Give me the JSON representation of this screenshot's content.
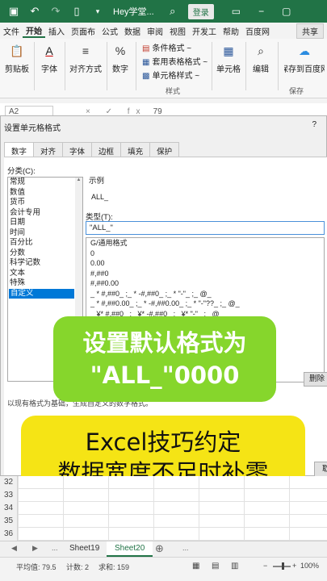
{
  "titlebar": {
    "title": "Hey学堂...",
    "login": "登录",
    "icons": [
      "save-icon",
      "undo-icon",
      "redo-icon",
      "document-icon",
      "search-icon",
      "ribbon-icon",
      "minimize-icon",
      "restore-icon"
    ]
  },
  "menu": {
    "tabs": [
      "文件",
      "开始",
      "插入",
      "页面布",
      "公式",
      "数据",
      "审阅",
      "视图",
      "开发工",
      "帮助",
      "百度网"
    ],
    "active": "开始",
    "share": "共享"
  },
  "ribbon": {
    "clipboard": "剪贴板",
    "font": "字体",
    "alignment": "对齐方式",
    "number": "数字",
    "conditional": "条件格式 ~",
    "table_format": "套用表格格式 ~",
    "cell_style": "单元格样式 ~",
    "styles": "样式",
    "cells": "单元格",
    "editing": "编辑",
    "save_to": "保存到百度网",
    "save": "保存"
  },
  "formula": {
    "cell": "A2",
    "fx": "× ✓ fx",
    "value": "79"
  },
  "dialog": {
    "title": "设置单元格格式",
    "help": "?",
    "tabs": [
      "数字",
      "对齐",
      "字体",
      "边框",
      "填充",
      "保护"
    ],
    "active_tab": "数字",
    "category_label": "分类(C):",
    "categories": [
      "常规",
      "数值",
      "货币",
      "会计专用",
      "日期",
      "时间",
      "百分比",
      "分数",
      "科学记数",
      "文本",
      "特殊",
      "自定义"
    ],
    "selected_category": "自定义",
    "sample_label": "示例",
    "sample_value": "ALL_",
    "type_label": "类型(T):",
    "type_value": "\"ALL_\"",
    "formats": [
      "G/通用格式",
      "0",
      "0.00",
      "#,##0",
      "#,##0.00",
      "_ * #,##0_ ;_ * -#,##0_ ;_ * \"-\"_ ;_ @_",
      "_ * #,##0.00_ ;_ * -#,##0.00_ ;_ * \"-\"??_ ;_ @_",
      "_ ¥* #,##0_ ;_ ¥* -#,##0_ ;_ ¥* \"-\"_ ;_ @_"
    ],
    "delete": "删除",
    "hint": "以现有格式为基础，生成自定义的数字格式。",
    "ok": "取"
  },
  "captions": {
    "line1": "设置默认格式为",
    "line2": "\"ALL_\"0000",
    "line3": "Excel技巧约定",
    "line4": "数据宽度不足时补零"
  },
  "rows": [
    "32",
    "33",
    "34",
    "35",
    "36"
  ],
  "sheets": {
    "nav_prev": "◀",
    "nav_next": "▶",
    "ellipsis": "...",
    "tabs": [
      "Sheet19",
      "Sheet20"
    ],
    "active": "Sheet20",
    "add": "⊕"
  },
  "status": {
    "average": "平均值: 79.5",
    "count": "计数: 2",
    "sum": "求和: 159",
    "zoom": "100%",
    "minus": "−",
    "plus": "+"
  },
  "colors": {
    "excel_green": "#217346",
    "caption_green": "#86d62c",
    "caption_yellow": "#f5e415",
    "selection_blue": "#0078d7"
  }
}
